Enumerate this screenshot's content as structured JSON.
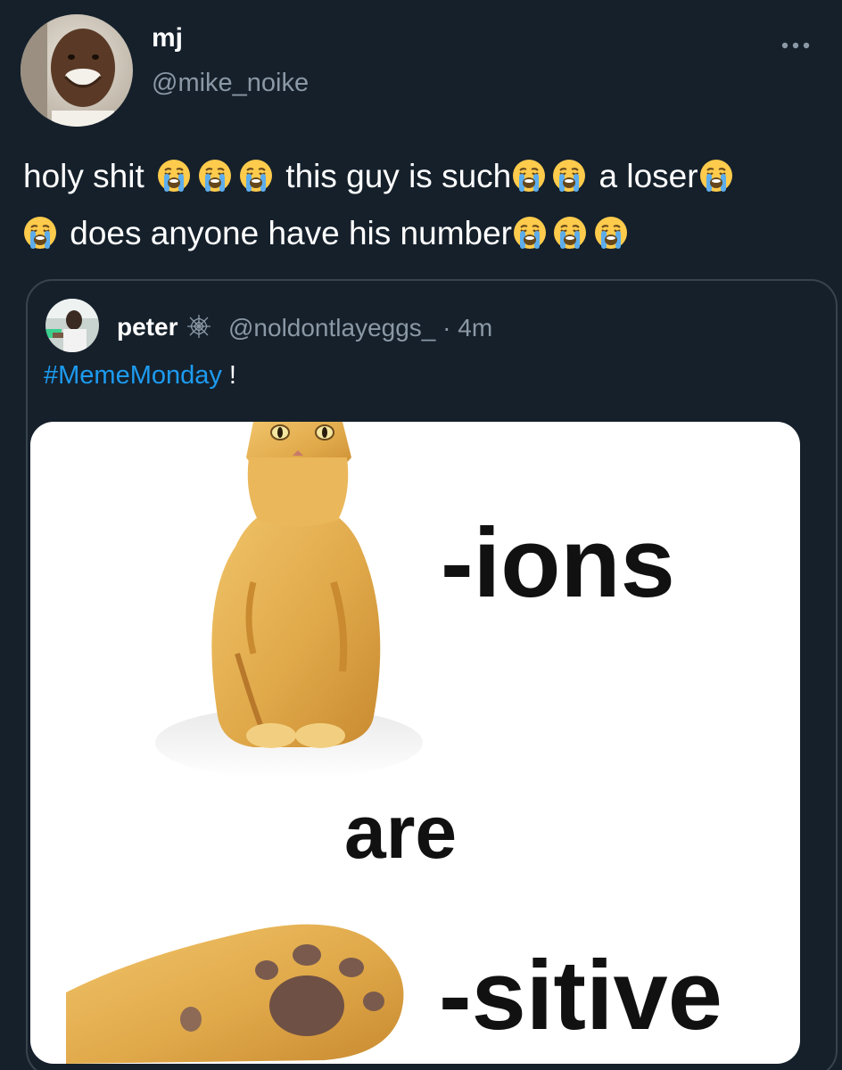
{
  "author": {
    "display_name": "mj",
    "handle": "@mike_noike"
  },
  "tweet": {
    "segments": [
      {
        "type": "text",
        "value": "holy shit "
      },
      {
        "type": "emoji",
        "value": "loudly-crying-face"
      },
      {
        "type": "emoji",
        "value": "loudly-crying-face"
      },
      {
        "type": "emoji",
        "value": "loudly-crying-face"
      },
      {
        "type": "text",
        "value": " this guy is such"
      },
      {
        "type": "emoji",
        "value": "loudly-crying-face"
      },
      {
        "type": "emoji",
        "value": "loudly-crying-face"
      },
      {
        "type": "text",
        "value": " a loser"
      },
      {
        "type": "emoji",
        "value": "loudly-crying-face"
      },
      {
        "type": "emoji",
        "value": "loudly-crying-face"
      },
      {
        "type": "text",
        "value": " does anyone have his number"
      },
      {
        "type": "emoji",
        "value": "loudly-crying-face"
      },
      {
        "type": "emoji",
        "value": "loudly-crying-face"
      },
      {
        "type": "emoji",
        "value": "loudly-crying-face"
      }
    ],
    "t1": "holy shit ",
    "t2": " this guy is such",
    "t3": " a loser",
    "t4": " does anyone have his number"
  },
  "more_icon": "more-horizontal-icon",
  "quoted": {
    "display_name": "peter",
    "badge_icon": "spider-web-icon",
    "handle": "@noldontlayeggs_",
    "separator": " · ",
    "time": "4m",
    "hashtag": "#MemeMonday",
    "text_after": " !",
    "media": {
      "word1": "-ions",
      "word2": "are",
      "word3": "-sitive"
    }
  },
  "colors": {
    "background": "#15202b",
    "secondary_text": "#8b98a5",
    "link": "#1d9bf0",
    "border": "#38444d"
  }
}
